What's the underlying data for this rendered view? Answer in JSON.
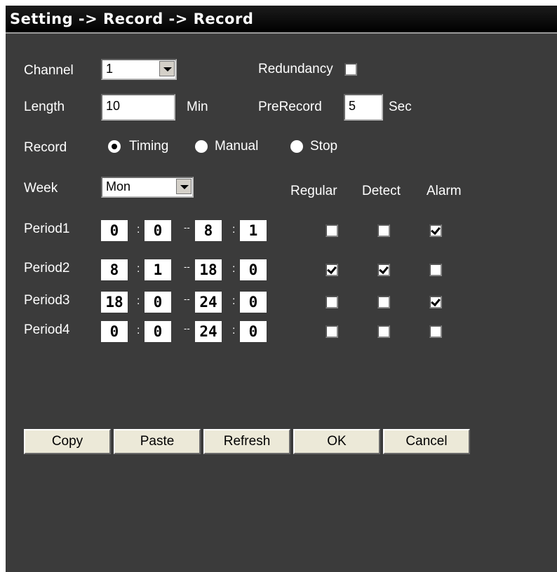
{
  "title": "Setting -> Record -> Record",
  "channel": {
    "label": "Channel",
    "value": "1"
  },
  "redundancy": {
    "label": "Redundancy",
    "checked": false
  },
  "length": {
    "label": "Length",
    "value": "10",
    "unit": "Min"
  },
  "prerecord": {
    "label": "PreRecord",
    "value": "5",
    "unit": "Sec"
  },
  "record": {
    "label": "Record",
    "options": [
      {
        "label": "Timing",
        "selected": true
      },
      {
        "label": "Manual",
        "selected": false
      },
      {
        "label": "Stop",
        "selected": false
      }
    ]
  },
  "week": {
    "label": "Week",
    "value": "Mon"
  },
  "columns": {
    "regular": "Regular",
    "detect": "Detect",
    "alarm": "Alarm"
  },
  "periods": [
    {
      "label": "Period1",
      "start_h": "0",
      "start_m": "0",
      "end_h": "8",
      "end_m": "1",
      "regular": false,
      "detect": false,
      "alarm": true
    },
    {
      "label": "Period2",
      "start_h": "8",
      "start_m": "1",
      "end_h": "18",
      "end_m": "0",
      "regular": true,
      "detect": true,
      "alarm": false
    },
    {
      "label": "Period3",
      "start_h": "18",
      "start_m": "0",
      "end_h": "24",
      "end_m": "0",
      "regular": false,
      "detect": false,
      "alarm": true
    },
    {
      "label": "Period4",
      "start_h": "0",
      "start_m": "0",
      "end_h": "24",
      "end_m": "0",
      "regular": false,
      "detect": false,
      "alarm": false
    }
  ],
  "time_colon": ":",
  "time_dash": "--",
  "buttons": {
    "copy": "Copy",
    "paste": "Paste",
    "refresh": "Refresh",
    "ok": "OK",
    "cancel": "Cancel"
  }
}
